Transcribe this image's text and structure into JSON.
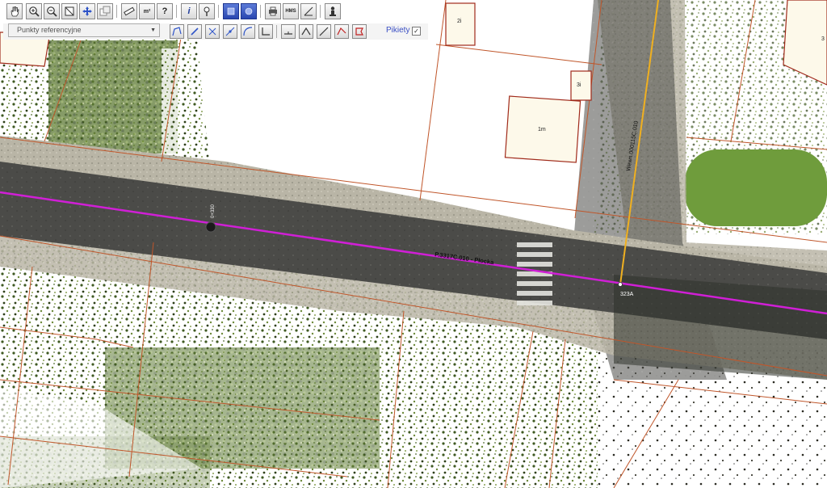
{
  "layer_select": {
    "value": "Punkty referencyjne"
  },
  "pikiety": {
    "label": "Pikiety",
    "checked": "✓"
  },
  "toolbar": {
    "hms_label": "HMS",
    "m2_label": "m²",
    "help_label": "?",
    "info_label": "i"
  },
  "map": {
    "road_label": "P.3317C.010 - Płocka",
    "cross_road_label": "Wewn.000115C.010",
    "point_label": "323A",
    "marker_label": "0+330",
    "parcels": [
      "2i",
      "3i",
      "1m",
      "3"
    ]
  },
  "colors": {
    "road_line": "#d01fd6",
    "cross_line": "#f0b020",
    "parcel_border": "#c0562a",
    "building_fill": "#fdf9ea",
    "building_border": "#a02a1a",
    "asphalt": "#4a4a48",
    "vegetation": "#4f6a2e"
  },
  "icons": [
    "hand-icon",
    "zoom-in-icon",
    "zoom-out-icon",
    "zoom-extent-icon",
    "pan-icon",
    "zoom-window-icon",
    "measure-icon",
    "area-icon",
    "help-icon",
    "info-icon",
    "identify-icon",
    "layers-icon",
    "layers-alt-icon",
    "print-icon",
    "hms-icon",
    "angle-icon",
    "person-icon"
  ]
}
